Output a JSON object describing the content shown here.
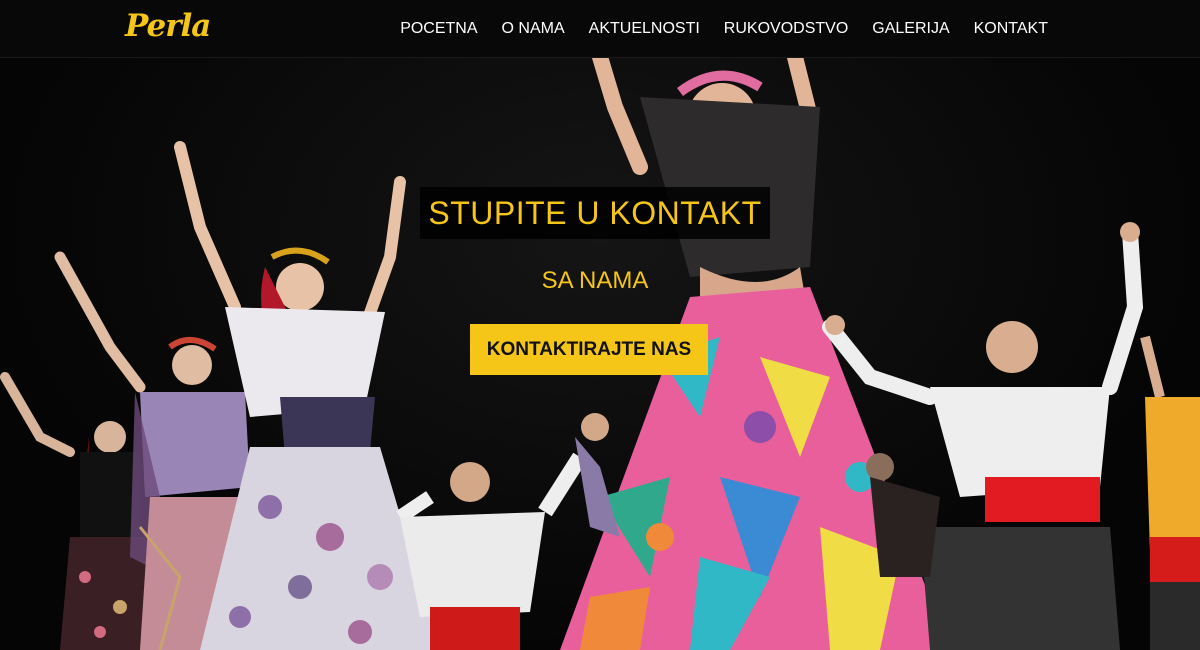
{
  "brand": {
    "logo_text": "Perla",
    "color": "#f5c518"
  },
  "nav": {
    "items": [
      {
        "label": "POCETNA"
      },
      {
        "label": "O NAMA"
      },
      {
        "label": "AKTUELNOSTI"
      },
      {
        "label": "RUKOVODSTVO"
      },
      {
        "label": "GALERIJA"
      },
      {
        "label": "KONTAKT"
      }
    ]
  },
  "hero": {
    "title": "STUPITE U KONTAKT",
    "subtitle": "SA NAMA",
    "cta_label": "KONTAKTIRAJTE NAS",
    "background_description_icon": "folk-dancers-photo"
  },
  "colors": {
    "accent": "#f5c518",
    "nav_bg": "#080808",
    "hero_bg": "#050505"
  }
}
